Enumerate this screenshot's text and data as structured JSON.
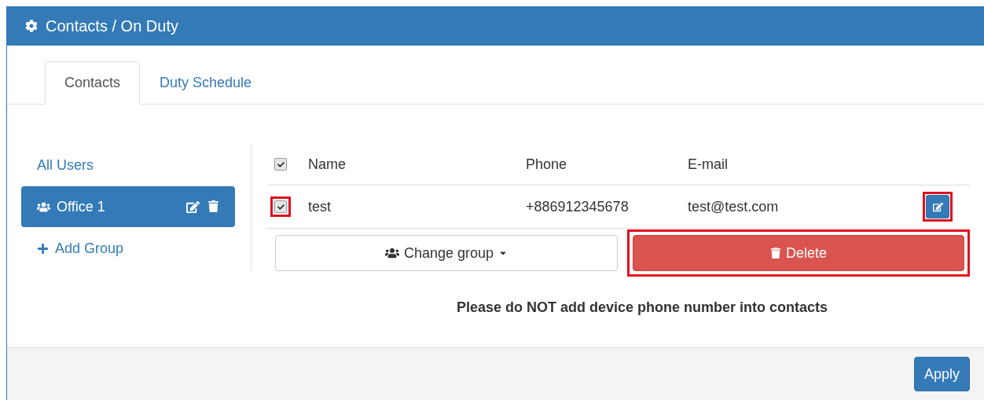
{
  "panel": {
    "title": "Contacts / On Duty"
  },
  "tabs": [
    {
      "label": "Contacts",
      "selected": true
    },
    {
      "label": "Duty Schedule",
      "selected": false
    }
  ],
  "sidebar": {
    "items": [
      {
        "kind": "link",
        "label": "All Users",
        "selected": false
      },
      {
        "kind": "group",
        "label": "Office 1",
        "selected": true
      },
      {
        "kind": "add",
        "label": "Add Group",
        "selected": false
      }
    ]
  },
  "table": {
    "select_all_checked": true,
    "columns": [
      "Name",
      "Phone",
      "E-mail"
    ],
    "rows": [
      {
        "checked": true,
        "checkbox_highlighted": true,
        "edit_highlighted": true,
        "cells": [
          "test",
          "+886912345678",
          "test@test.com"
        ]
      }
    ]
  },
  "actions": {
    "change_group": "Change group",
    "delete": "Delete",
    "delete_highlighted": true
  },
  "notice": "Please do NOT add device phone number into contacts",
  "footer": {
    "apply": "Apply"
  }
}
